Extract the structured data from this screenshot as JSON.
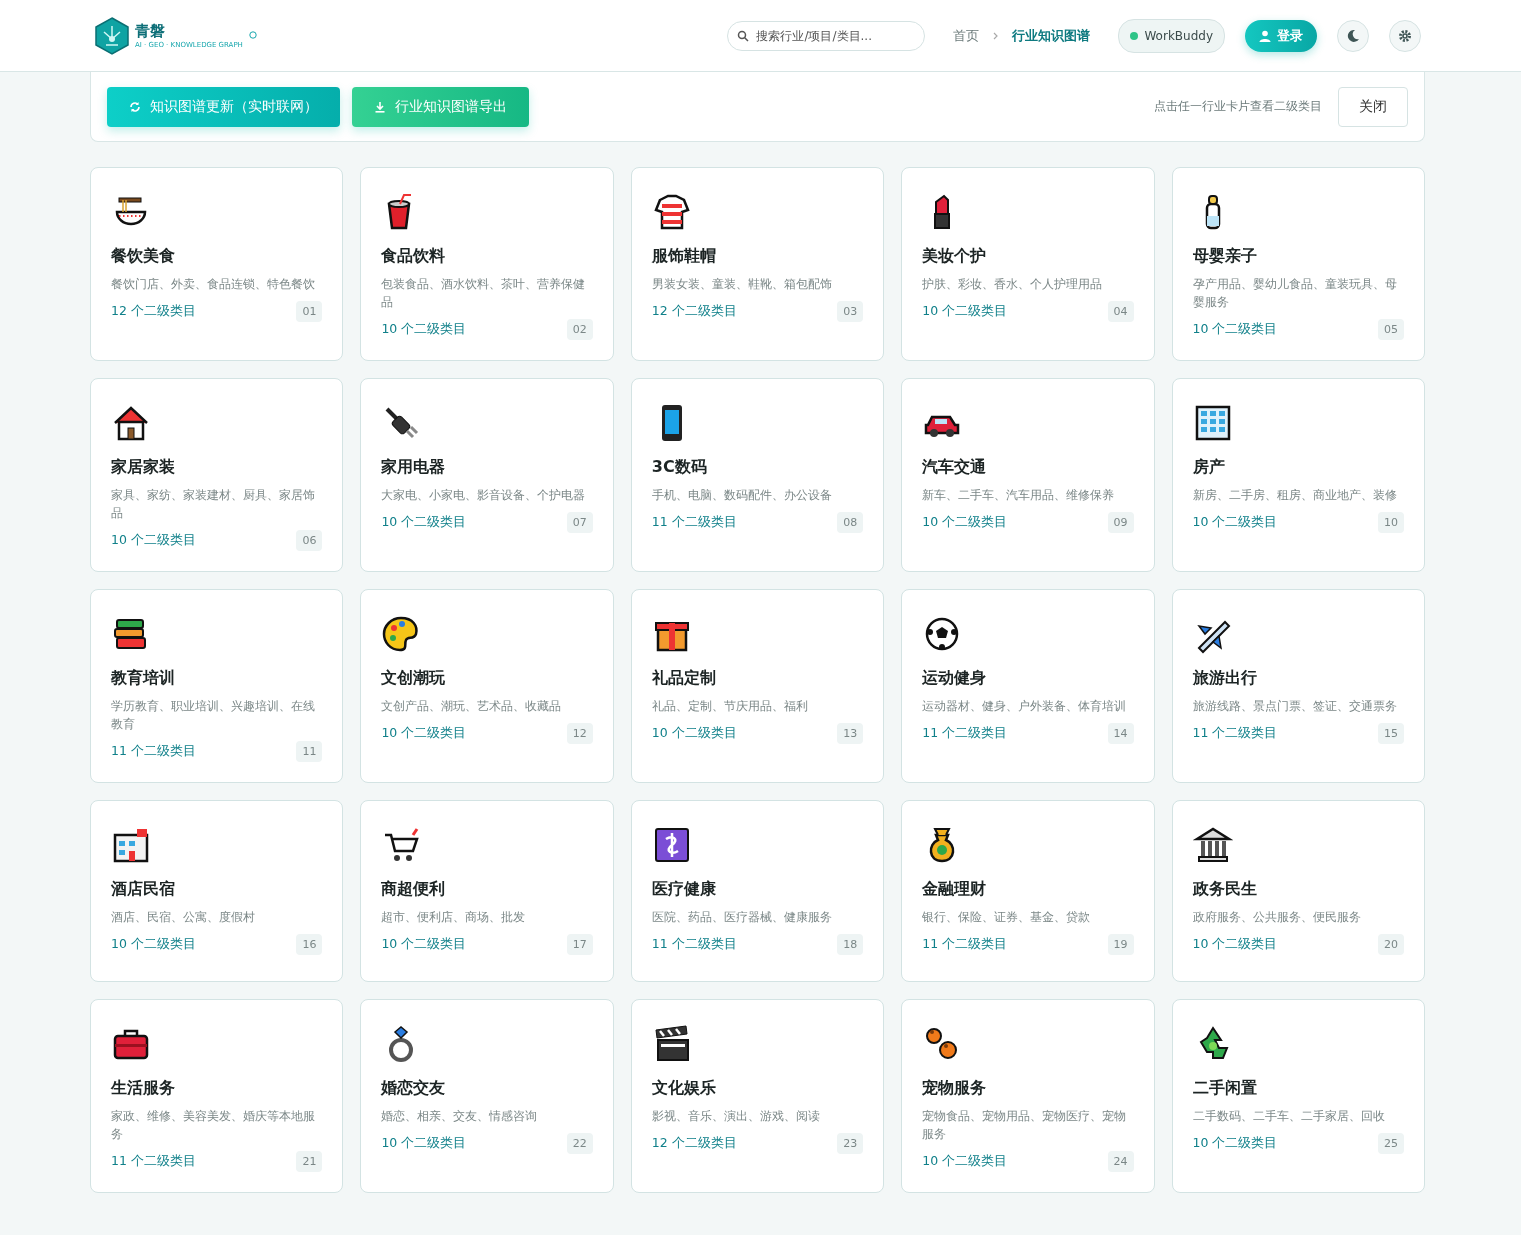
{
  "header": {
    "logo": {
      "name": "青磐",
      "tagline": "AI · GEO · KNOWLEDGE GRAPH"
    },
    "search": {
      "placeholder": "搜索行业/项目/类目..."
    },
    "breadcrumb": [
      {
        "label": "首页",
        "selected": false
      },
      {
        "label": "行业知识图谱",
        "selected": true
      }
    ],
    "status": {
      "label": "WorkBuddy",
      "online": true
    },
    "login": "登录"
  },
  "toolbar": {
    "buttons": [
      {
        "label": "知识图谱更新（实时联网）",
        "kind": "refresh"
      },
      {
        "label": "行业知识图谱导出",
        "kind": "export"
      }
    ],
    "hint": "点击任一行业卡片查看二级类目",
    "close": "关闭"
  },
  "cards": [
    {
      "title": "餐饮美食",
      "desc": "餐饮门店、外卖、食品连锁、特色餐饮",
      "count": "12 个二级类目",
      "number": "01"
    },
    {
      "title": "食品饮料",
      "desc": "包装食品、酒水饮料、茶叶、营养保健品",
      "count": "10 个二级类目",
      "number": "02"
    },
    {
      "title": "服饰鞋帽",
      "desc": "男装女装、童装、鞋靴、箱包配饰",
      "count": "12 个二级类目",
      "number": "03"
    },
    {
      "title": "美妆个护",
      "desc": "护肤、彩妆、香水、个人护理用品",
      "count": "10 个二级类目",
      "number": "04"
    },
    {
      "title": "母婴亲子",
      "desc": "孕产用品、婴幼儿食品、童装玩具、母婴服务",
      "count": "10 个二级类目",
      "number": "05"
    },
    {
      "title": "家居家装",
      "desc": "家具、家纺、家装建材、厨具、家居饰品",
      "count": "10 个二级类目",
      "number": "06"
    },
    {
      "title": "家用电器",
      "desc": "大家电、小家电、影音设备、个护电器",
      "count": "10 个二级类目",
      "number": "07"
    },
    {
      "title": "3C数码",
      "desc": "手机、电脑、数码配件、办公设备",
      "count": "11 个二级类目",
      "number": "08"
    },
    {
      "title": "汽车交通",
      "desc": "新车、二手车、汽车用品、维修保养",
      "count": "10 个二级类目",
      "number": "09"
    },
    {
      "title": "房产",
      "desc": "新房、二手房、租房、商业地产、装修",
      "count": "10 个二级类目",
      "number": "10"
    },
    {
      "title": "教育培训",
      "desc": "学历教育、职业培训、兴趣培训、在线教育",
      "count": "11 个二级类目",
      "number": "11"
    },
    {
      "title": "文创潮玩",
      "desc": "文创产品、潮玩、艺术品、收藏品",
      "count": "10 个二级类目",
      "number": "12"
    },
    {
      "title": "礼品定制",
      "desc": "礼品、定制、节庆用品、福利",
      "count": "10 个二级类目",
      "number": "13"
    },
    {
      "title": "运动健身",
      "desc": "运动器材、健身、户外装备、体育培训",
      "count": "11 个二级类目",
      "number": "14"
    },
    {
      "title": "旅游出行",
      "desc": "旅游线路、景点门票、签证、交通票务",
      "count": "11 个二级类目",
      "number": "15"
    },
    {
      "title": "酒店民宿",
      "desc": "酒店、民宿、公寓、度假村",
      "count": "10 个二级类目",
      "number": "16"
    },
    {
      "title": "商超便利",
      "desc": "超市、便利店、商场、批发",
      "count": "10 个二级类目",
      "number": "17"
    },
    {
      "title": "医疗健康",
      "desc": "医院、药品、医疗器械、健康服务",
      "count": "11 个二级类目",
      "number": "18"
    },
    {
      "title": "金融理财",
      "desc": "银行、保险、证券、基金、贷款",
      "count": "11 个二级类目",
      "number": "19"
    },
    {
      "title": "政务民生",
      "desc": "政府服务、公共服务、便民服务",
      "count": "10 个二级类目",
      "number": "20"
    },
    {
      "title": "生活服务",
      "desc": "家政、维修、美容美发、婚庆等本地服务",
      "count": "11 个二级类目",
      "number": "21"
    },
    {
      "title": "婚恋交友",
      "desc": "婚恋、相亲、交友、情感咨询",
      "count": "10 个二级类目",
      "number": "22"
    },
    {
      "title": "文化娱乐",
      "desc": "影视、音乐、演出、游戏、阅读",
      "count": "12 个二级类目",
      "number": "23"
    },
    {
      "title": "宠物服务",
      "desc": "宠物食品、宠物用品、宠物医疗、宠物服务",
      "count": "10 个二级类目",
      "number": "24"
    },
    {
      "title": "二手闲置",
      "desc": "二手数码、二手车、二手家居、回收",
      "count": "10 个二级类目",
      "number": "25"
    }
  ]
}
